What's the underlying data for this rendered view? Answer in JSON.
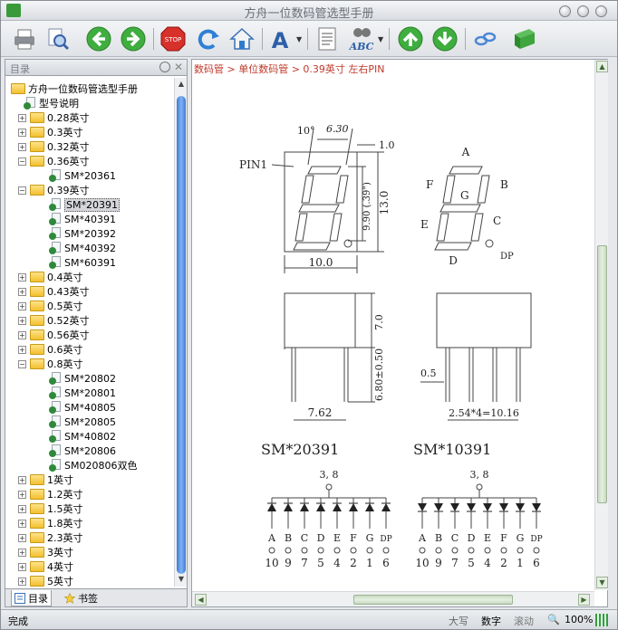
{
  "window": {
    "title": "方舟一位数码管选型手册"
  },
  "left_panel": {
    "title": "目录",
    "tabs": [
      "目录",
      "书签"
    ],
    "tree": [
      {
        "label": "方舟一位数码管选型手册",
        "type": "root"
      },
      {
        "label": "型号说明",
        "type": "leaf",
        "level": 1
      },
      {
        "label": "0.28英寸",
        "type": "folder",
        "expanded": false
      },
      {
        "label": "0.3英寸",
        "type": "folder",
        "expanded": false
      },
      {
        "label": "0.32英寸",
        "type": "folder",
        "expanded": false
      },
      {
        "label": "0.36英寸",
        "type": "folder",
        "expanded": true
      },
      {
        "label": "SM*20361",
        "type": "leaf",
        "level": 2
      },
      {
        "label": "0.39英寸",
        "type": "folder",
        "expanded": true
      },
      {
        "label": "SM*20391",
        "type": "leaf",
        "level": 2,
        "selected": true
      },
      {
        "label": "SM*40391",
        "type": "leaf",
        "level": 2
      },
      {
        "label": "SM*20392",
        "type": "leaf",
        "level": 2
      },
      {
        "label": "SM*40392",
        "type": "leaf",
        "level": 2
      },
      {
        "label": "SM*60391",
        "type": "leaf",
        "level": 2
      },
      {
        "label": "0.4英寸",
        "type": "folder",
        "expanded": false
      },
      {
        "label": "0.43英寸",
        "type": "folder",
        "expanded": false
      },
      {
        "label": "0.5英寸",
        "type": "folder",
        "expanded": false
      },
      {
        "label": "0.52英寸",
        "type": "folder",
        "expanded": false
      },
      {
        "label": "0.56英寸",
        "type": "folder",
        "expanded": false
      },
      {
        "label": "0.6英寸",
        "type": "folder",
        "expanded": false
      },
      {
        "label": "0.8英寸",
        "type": "folder",
        "expanded": true
      },
      {
        "label": "SM*20802",
        "type": "leaf",
        "level": 2
      },
      {
        "label": "SM*20801",
        "type": "leaf",
        "level": 2
      },
      {
        "label": "SM*40805",
        "type": "leaf",
        "level": 2
      },
      {
        "label": "SM*20805",
        "type": "leaf",
        "level": 2
      },
      {
        "label": "SM*40802",
        "type": "leaf",
        "level": 2
      },
      {
        "label": "SM*20806",
        "type": "leaf",
        "level": 2
      },
      {
        "label": "SM020806双色",
        "type": "leaf",
        "level": 2
      },
      {
        "label": "1英寸",
        "type": "folder",
        "expanded": false
      },
      {
        "label": "1.2英寸",
        "type": "folder",
        "expanded": false
      },
      {
        "label": "1.5英寸",
        "type": "folder",
        "expanded": false
      },
      {
        "label": "1.8英寸",
        "type": "folder",
        "expanded": false
      },
      {
        "label": "2.3英寸",
        "type": "folder",
        "expanded": false
      },
      {
        "label": "3英寸",
        "type": "folder",
        "expanded": false
      },
      {
        "label": "4英寸",
        "type": "folder",
        "expanded": false
      },
      {
        "label": "5英寸",
        "type": "folder",
        "expanded": false
      }
    ]
  },
  "content": {
    "breadcrumb": "数码管 > 单位数码管 > 0.39英寸   左右PIN",
    "drawing": {
      "pin1_label": "PIN1",
      "angle_label": "10°",
      "dim_top": "6.30",
      "dim_1_0": "1.0",
      "dim_height_inner": "9.90 (.39\")",
      "dim_height": "13.0",
      "dim_width": "10.0",
      "dim_body": "7.0",
      "dim_pins": "6.80±0.50",
      "dim_pitch_row": "7.62",
      "dim_0_5": "0.5",
      "dim_pitch": "2.54*4=10.16",
      "segments": [
        "A",
        "B",
        "C",
        "D",
        "E",
        "F",
        "G",
        "DP"
      ],
      "model_left": "SM*20391",
      "model_right": "SM*10391",
      "common_pins": "3, 8",
      "seg_labels": [
        "A",
        "B",
        "C",
        "D",
        "E",
        "F",
        "G",
        "DP"
      ],
      "pin_numbers": [
        "10",
        "9",
        "7",
        "5",
        "4",
        "2",
        "1",
        "6"
      ]
    }
  },
  "status": {
    "left": "完成",
    "caps": "大写",
    "num": "数字",
    "scroll": "滚动",
    "zoom": "100%"
  }
}
